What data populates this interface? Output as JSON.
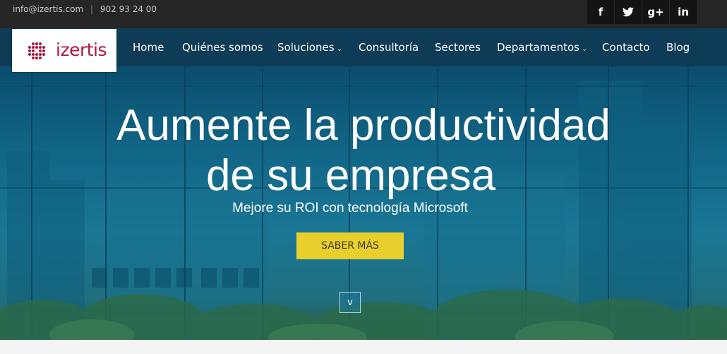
{
  "topbar": {
    "email": "info@izertis.com",
    "separator": "|",
    "phone": "902 93 24 00",
    "social": [
      {
        "icon": "facebook-icon",
        "glyph": "f"
      },
      {
        "icon": "twitter-icon",
        "glyph": "𝕥"
      },
      {
        "icon": "google-plus-icon",
        "glyph": "g+"
      },
      {
        "icon": "linkedin-icon",
        "glyph": "in"
      }
    ]
  },
  "logo": {
    "text": "izertis",
    "color": "#b0153d"
  },
  "nav": {
    "items": [
      {
        "label": "Home"
      },
      {
        "label": "Quiénes somos"
      },
      {
        "label": "Soluciones",
        "dropdown": true
      },
      {
        "label": "Consultoría"
      },
      {
        "label": "Sectores"
      },
      {
        "label": "Departamentos",
        "dropdown": true
      },
      {
        "label": "Contacto"
      },
      {
        "label": "Blog"
      }
    ],
    "chevron": "⌄"
  },
  "hero": {
    "headline_line1": "Aumente la productividad",
    "headline_line2": "de su empresa",
    "subheadline": "Mejore su ROI con tecnología Microsoft",
    "cta_label": "SABER MÁS",
    "cta_color": "#e9cf2c",
    "scroll_glyph": "v"
  }
}
